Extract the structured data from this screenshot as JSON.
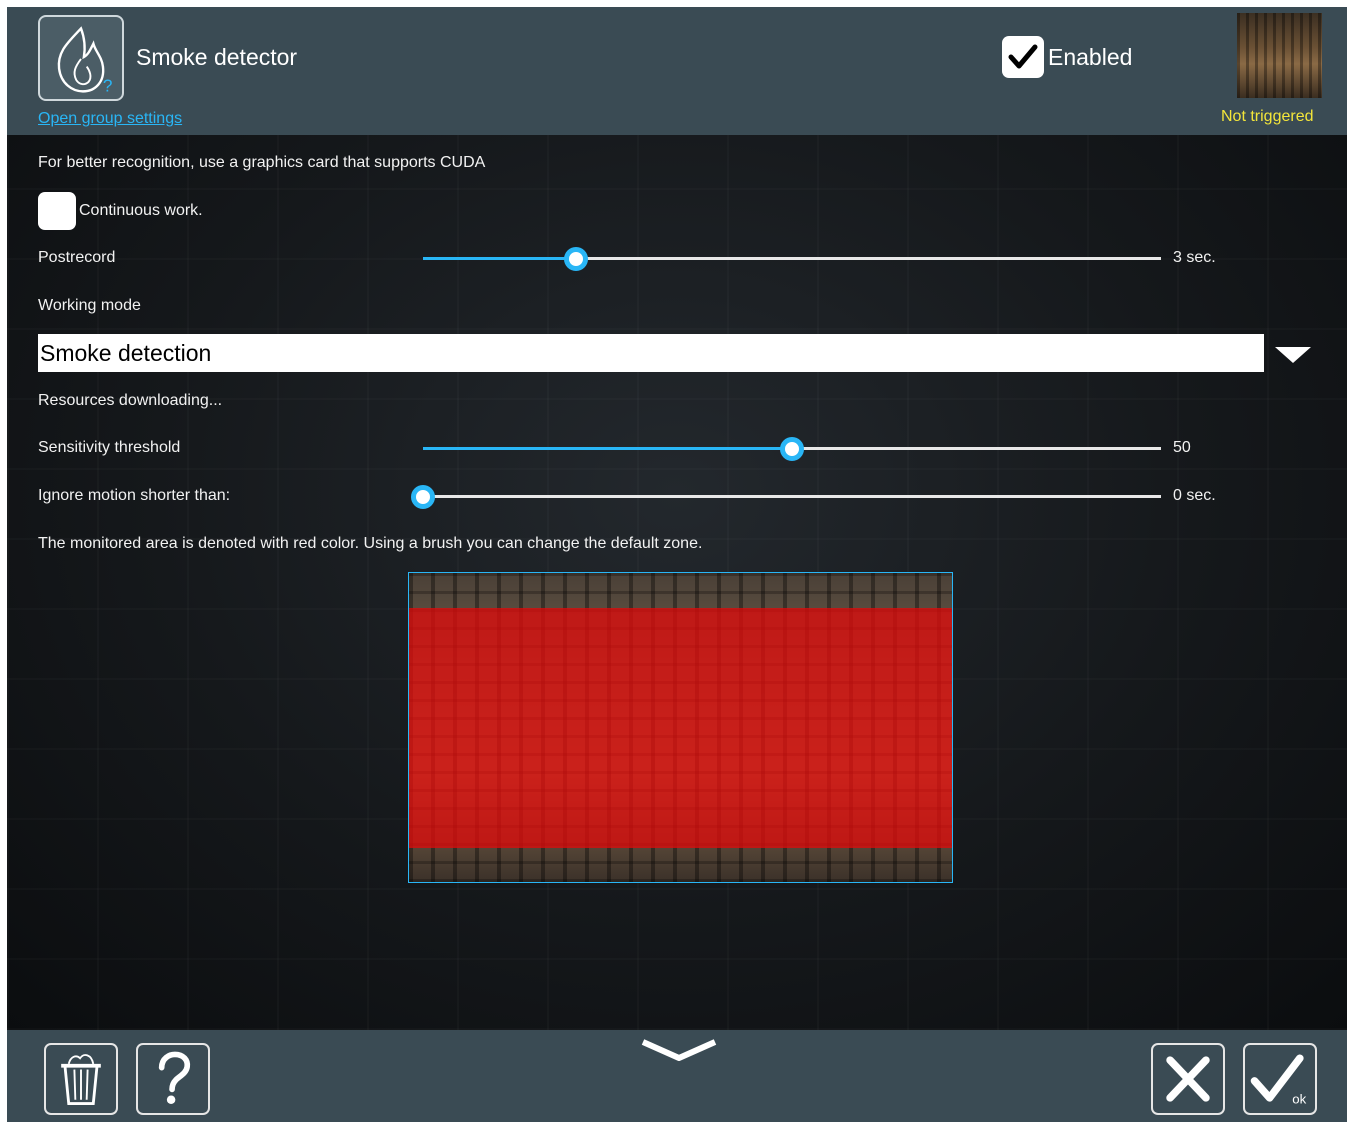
{
  "header": {
    "title": "Smoke detector",
    "group_link": "Open group settings",
    "enabled_label": "Enabled",
    "enabled_checked": true,
    "status": "Not triggered",
    "status_color": "#f3e53a"
  },
  "settings": {
    "cuda_note": "For better recognition, use a graphics card that supports CUDA",
    "continuous_work": {
      "label": "Continuous work.",
      "checked": false
    },
    "postrecord": {
      "label": "Postrecord",
      "value_text": "3 sec.",
      "fraction": 0.207
    },
    "working_mode": {
      "label": "Working mode",
      "selected": "Smoke detection"
    },
    "resources_status": "Resources downloading...",
    "sensitivity": {
      "label": "Sensitivity threshold",
      "value_text": "50",
      "fraction": 0.5
    },
    "ignore_motion": {
      "label": "Ignore motion shorter than:",
      "value_text": "0 sec.",
      "fraction": 0.0
    },
    "zone_note": "The monitored area is denoted with red color. Using a brush you can change the default zone."
  },
  "colors": {
    "accent": "#29b6f6",
    "header_bg": "#3a4b54",
    "zone_mask": "#dc0c0c"
  },
  "icons": {
    "detector": "flame-icon",
    "enabled": "checkmark-icon",
    "collapse": "chevron-down-icon",
    "delete": "trash-icon",
    "help": "question-icon",
    "cancel": "close-icon",
    "ok": "ok-check-icon"
  },
  "footer": {
    "ok_sub": "ok"
  }
}
